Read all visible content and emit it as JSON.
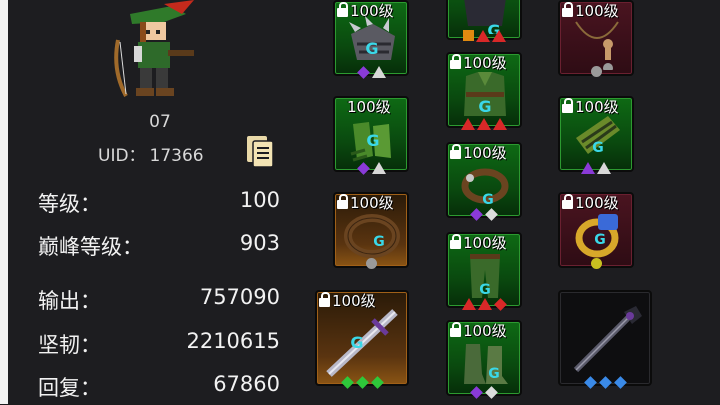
{
  "hero": {
    "name": "07",
    "uid_label": "UID：",
    "uid_value": "17366"
  },
  "stats": [
    {
      "label": "等级：",
      "value": "100"
    },
    {
      "label": "巅峰等级：",
      "value": "903"
    },
    {
      "label": "输出：",
      "value": "757090"
    },
    {
      "label": "坚韧：",
      "value": "2210615"
    },
    {
      "label": "回复：",
      "value": "67860"
    }
  ],
  "equipment": {
    "col1": [
      {
        "level": "100级",
        "locked": true,
        "rarity": "green",
        "icon": "spiked-pauldron-icon",
        "gems": [
          "purple-diamond",
          "white-triangle"
        ]
      },
      {
        "level": "100级",
        "locked": false,
        "rarity": "green",
        "icon": "green-gloves-icon",
        "gems": [
          "purple-diamond",
          "white-triangle"
        ]
      },
      {
        "level": "100级",
        "locked": true,
        "rarity": "orange",
        "icon": "leather-belt-icon",
        "gems": [
          "gray-round"
        ]
      },
      {
        "level": "100级",
        "locked": true,
        "rarity": "orange",
        "icon": "jeweled-sword-icon",
        "gems": [
          "green-diamond",
          "green-diamond",
          "green-diamond"
        ]
      }
    ],
    "col2": [
      {
        "level": "",
        "locked": false,
        "rarity": "green",
        "icon": "dark-helmet-icon",
        "gems": [
          "orange-square",
          "red-triangle",
          "red-triangle"
        ]
      },
      {
        "level": "100级",
        "locked": true,
        "rarity": "green",
        "icon": "green-tunic-icon",
        "gems": [
          "red-triangle",
          "red-triangle",
          "red-triangle"
        ]
      },
      {
        "level": "100级",
        "locked": true,
        "rarity": "green",
        "icon": "leather-bracelet-icon",
        "gems": [
          "purple-diamond",
          "white-diamond"
        ]
      },
      {
        "level": "100级",
        "locked": true,
        "rarity": "green",
        "icon": "green-leggings-icon",
        "gems": [
          "red-triangle",
          "red-triangle",
          "red-diamond"
        ]
      },
      {
        "level": "100级",
        "locked": true,
        "rarity": "green",
        "icon": "green-boots-icon",
        "gems": [
          "purple-diamond",
          "white-diamond"
        ]
      }
    ],
    "col3": [
      {
        "level": "100级",
        "locked": true,
        "rarity": "red",
        "icon": "voodoo-doll-amulet-icon",
        "gems": [
          "gray-round"
        ]
      },
      {
        "level": "100级",
        "locked": true,
        "rarity": "green",
        "icon": "green-bracer-icon",
        "gems": [
          "purple-triangle",
          "white-triangle"
        ]
      },
      {
        "level": "100级",
        "locked": true,
        "rarity": "red",
        "icon": "gold-ring-icon",
        "gems": [
          "yellow-round"
        ]
      },
      {
        "level": "",
        "locked": false,
        "rarity": "dark",
        "icon": "dark-sword-icon",
        "gems": [
          "blue-diamond",
          "blue-diamond",
          "blue-diamond"
        ]
      }
    ]
  },
  "colors": {
    "panel_bg": "#1d1d20",
    "epic_green": "#0e6a14",
    "legend_red": "#4a1420",
    "rare_orange": "#8a5414"
  }
}
